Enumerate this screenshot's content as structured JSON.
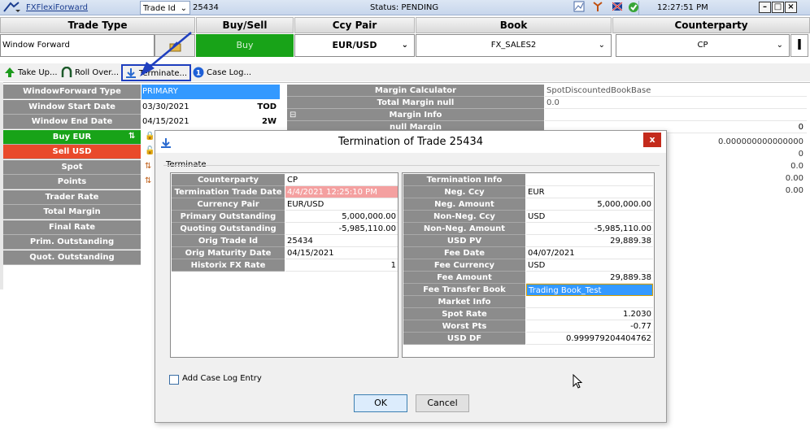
{
  "topbar": {
    "app_link": "FXFlexiForward",
    "id_select": "Trade Id",
    "trade_id": "25434",
    "status": "Status: PENDING",
    "time": "12:27:51 PM"
  },
  "header": {
    "trade_type": {
      "label": "Trade Type",
      "value": "Window Forward"
    },
    "buy_sell": {
      "label": "Buy/Sell",
      "value": "Buy"
    },
    "ccy_pair": {
      "label": "Ccy Pair",
      "value": "EUR/USD"
    },
    "book": {
      "label": "Book",
      "value": "FX_SALES2"
    },
    "counterparty": {
      "label": "Counterparty",
      "value": "CP"
    }
  },
  "toolbar": {
    "take_up": "Take Up...",
    "roll_over": "Roll Over...",
    "terminate": "Terminate...",
    "case_log": "Case Log..."
  },
  "left_grid": [
    {
      "label": "WindowForward Type",
      "value": "PRIMARY",
      "tag": ""
    },
    {
      "label": "Window Start Date",
      "value": "03/30/2021",
      "tag": "TOD"
    },
    {
      "label": "Window End Date",
      "value": "04/15/2021",
      "tag": "2W"
    },
    {
      "label": "Buy EUR",
      "value": "",
      "tag": ""
    },
    {
      "label": "Sell USD",
      "value": "",
      "tag": ""
    },
    {
      "label": "Spot",
      "value": "",
      "tag": ""
    },
    {
      "label": "Points",
      "value": "",
      "tag": ""
    },
    {
      "label": "Trader Rate",
      "value": "",
      "tag": ""
    },
    {
      "label": "Total Margin",
      "value": "",
      "tag": ""
    },
    {
      "label": "Final Rate",
      "value": "",
      "tag": ""
    },
    {
      "label": "Prim. Outstanding",
      "value": "",
      "tag": ""
    },
    {
      "label": "Quot. Outstanding",
      "value": "",
      "tag": ""
    }
  ],
  "margin_calc": [
    {
      "label": "Margin Calculator",
      "value": "SpotDiscountedBookBase"
    },
    {
      "label": "Total Margin null",
      "value": "0.0"
    },
    {
      "label": "Margin Info",
      "value": ""
    },
    {
      "label": "null Margin",
      "value": "0"
    }
  ],
  "margin_right_values": [
    "0.000000000000000",
    "0",
    "0.0",
    "0.00",
    "0.00"
  ],
  "dialog": {
    "title": "Termination of Trade 25434",
    "close": "x",
    "section": "Terminate",
    "left_rows": [
      {
        "label": "Counterparty",
        "value": "CP"
      },
      {
        "label": "Termination Trade Date",
        "value": "4/4/2021 12:25:10 PM"
      },
      {
        "label": "Currency Pair",
        "value": "EUR/USD"
      },
      {
        "label": "Primary Outstanding",
        "value": "5,000,000.00"
      },
      {
        "label": "Quoting Outstanding",
        "value": "-5,985,110.00"
      },
      {
        "label": "Orig Trade Id",
        "value": "25434"
      },
      {
        "label": "Orig Maturity Date",
        "value": "04/15/2021"
      },
      {
        "label": "Historix FX Rate",
        "value": "1"
      }
    ],
    "right_rows": [
      {
        "label": "Termination Info",
        "value": ""
      },
      {
        "label": "Neg. Ccy",
        "value": "EUR"
      },
      {
        "label": "Neg. Amount",
        "value": "5,000,000.00"
      },
      {
        "label": "Non-Neg. Ccy",
        "value": "USD"
      },
      {
        "label": "Non-Neg. Amount",
        "value": "-5,985,110.00"
      },
      {
        "label": "USD PV",
        "value": "29,889.38"
      },
      {
        "label": "Fee Date",
        "value": "04/07/2021"
      },
      {
        "label": "Fee Currency",
        "value": "USD"
      },
      {
        "label": "Fee Amount",
        "value": "29,889.38"
      },
      {
        "label": "Fee Transfer Book",
        "value": "Trading Book_Test"
      },
      {
        "label": "Market Info",
        "value": ""
      },
      {
        "label": "Spot Rate",
        "value": "1.2030"
      },
      {
        "label": "Worst Pts",
        "value": "-0.77"
      },
      {
        "label": "USD DF",
        "value": "0.999979204404762"
      }
    ],
    "checkbox_label": "Add Case Log Entry",
    "ok": "OK",
    "cancel": "Cancel"
  },
  "colors": {
    "buy_green": "#18a318",
    "sell_red": "#e94a2b",
    "label_grey": "#8c8c8c",
    "selection_blue": "#3399ff",
    "highlight_pink": "#f4a0a0",
    "annotation_blue": "#1f3fbf"
  }
}
